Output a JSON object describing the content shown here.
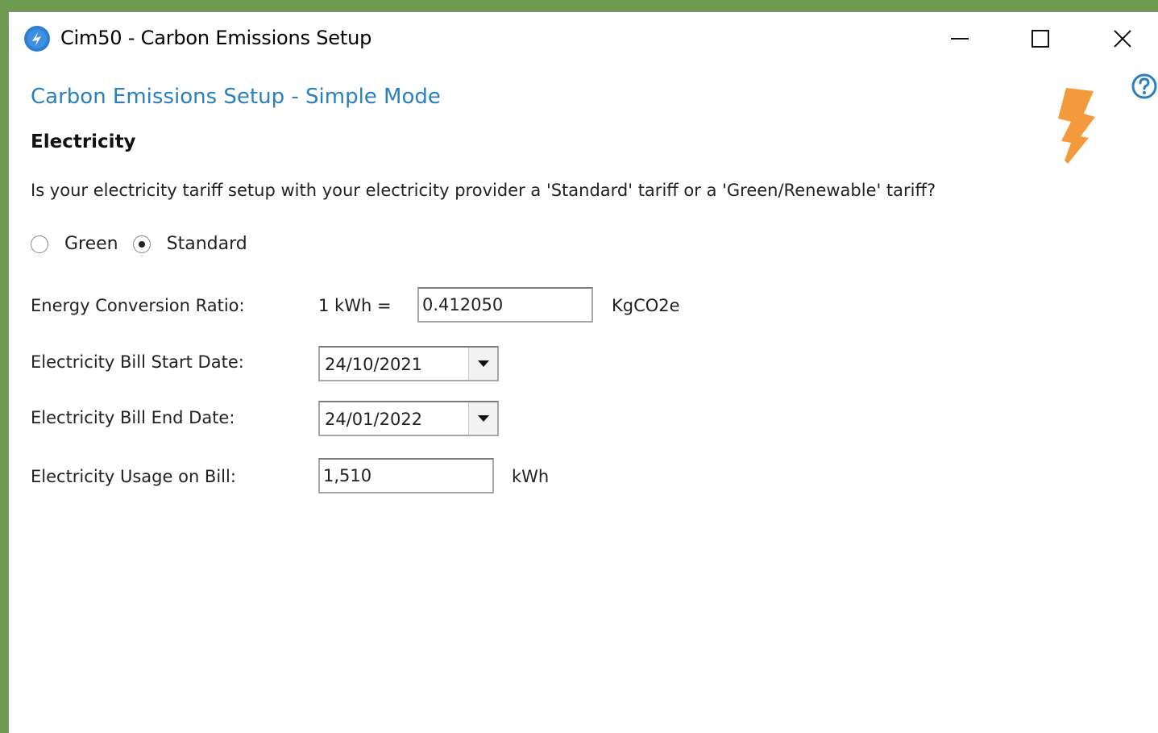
{
  "window": {
    "title": "Cim50 - Carbon Emissions Setup"
  },
  "page": {
    "heading": "Carbon Emissions Setup - Simple Mode",
    "section": "Electricity",
    "question": "Is your electricity tariff setup with your electricity provider a 'Standard' tariff or a 'Green/Renewable' tariff?"
  },
  "tariff": {
    "options": [
      {
        "label": "Green",
        "selected": false
      },
      {
        "label": "Standard",
        "selected": true
      }
    ]
  },
  "fields": {
    "conversion": {
      "label": "Energy Conversion Ratio:",
      "prefix": "1 kWh =",
      "value": "0.412050",
      "unit": "KgCO2e"
    },
    "start_date": {
      "label": "Electricity Bill Start Date:",
      "value": "24/10/2021"
    },
    "end_date": {
      "label": "Electricity Bill End Date:",
      "value": "24/01/2022"
    },
    "usage": {
      "label": "Electricity Usage on Bill:",
      "value": "1,510",
      "unit": "kWh"
    }
  },
  "colors": {
    "heading": "#2a7fbf",
    "bolt": "#f39a3c",
    "desktop": "#6e9a52"
  },
  "icons": {
    "app": "cim50-app-icon",
    "help": "help-icon",
    "bolt": "lightning-bolt-icon"
  }
}
